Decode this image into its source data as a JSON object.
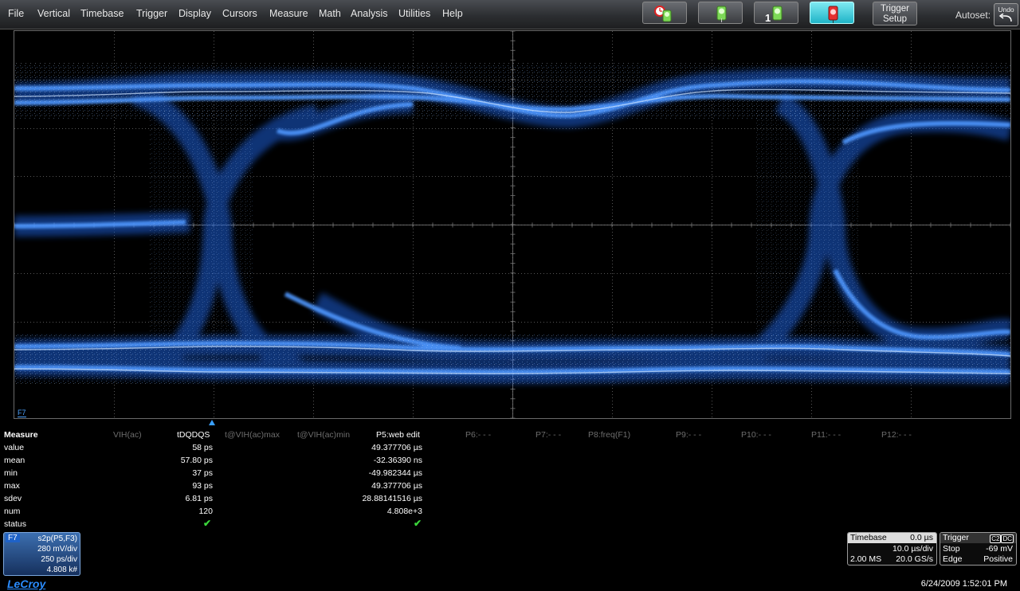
{
  "menu": {
    "items": [
      "File",
      "Vertical",
      "Timebase",
      "Trigger",
      "Display",
      "Cursors",
      "Measure",
      "Math",
      "Analysis",
      "Utilities",
      "Help"
    ],
    "trigger_setup": [
      "Trigger",
      "Setup"
    ],
    "autoset": "Autoset:",
    "undo": "Undo",
    "toolbar_badge": "1"
  },
  "measure": {
    "title": "Measure",
    "row_labels": [
      "value",
      "mean",
      "min",
      "max",
      "sdev",
      "num",
      "status"
    ],
    "headers": {
      "p1": "VIH(ac)",
      "p2": "tDQDQS",
      "p3": "t@VIH(ac)max",
      "p4": "t@VIH(ac)min",
      "p5": "P5:web edit",
      "p6": "P6:- - -",
      "p7": "P7:- - -",
      "p8": "P8:freq(F1)",
      "p9": "P9:- - -",
      "p10": "P10:- - -",
      "p11": "P11:- - -",
      "p12": "P12:- - -"
    },
    "p2_values": [
      "58 ps",
      "57.80 ps",
      "37 ps",
      "93 ps",
      "6.81 ps",
      "120"
    ],
    "p5_values": [
      "49.377706 µs",
      "-32.36390 ns",
      "-49.982344 µs",
      "49.377706 µs",
      "28.88141516 µs",
      "4.808e+3"
    ]
  },
  "trace": {
    "marker": "F7",
    "box": {
      "tag": "F7",
      "func": "s2p(P5,F3)",
      "vdiv": "280 mV/div",
      "hdiv": "250 ps/div",
      "count": "4.808 k#"
    }
  },
  "timebase": {
    "label": "Timebase",
    "delay": "0.0 µs",
    "tdiv": "10.0 µs/div",
    "samples": "2.00 MS",
    "rate": "20.0 GS/s"
  },
  "trigger": {
    "label": "Trigger",
    "channel": "C2",
    "coupling": "DC",
    "mode": "Stop",
    "level": "-69 mV",
    "type": "Edge",
    "slope": "Positive"
  },
  "brand": "LeCroy",
  "datetime": "6/24/2009 1:52:01 PM",
  "colors": {
    "trace": "#2f7fff",
    "trace_bright": "#cfe4ff",
    "grid": "#6a6a6a",
    "status_ok": "#3bd63b",
    "active_button": "#1fb4c7"
  }
}
